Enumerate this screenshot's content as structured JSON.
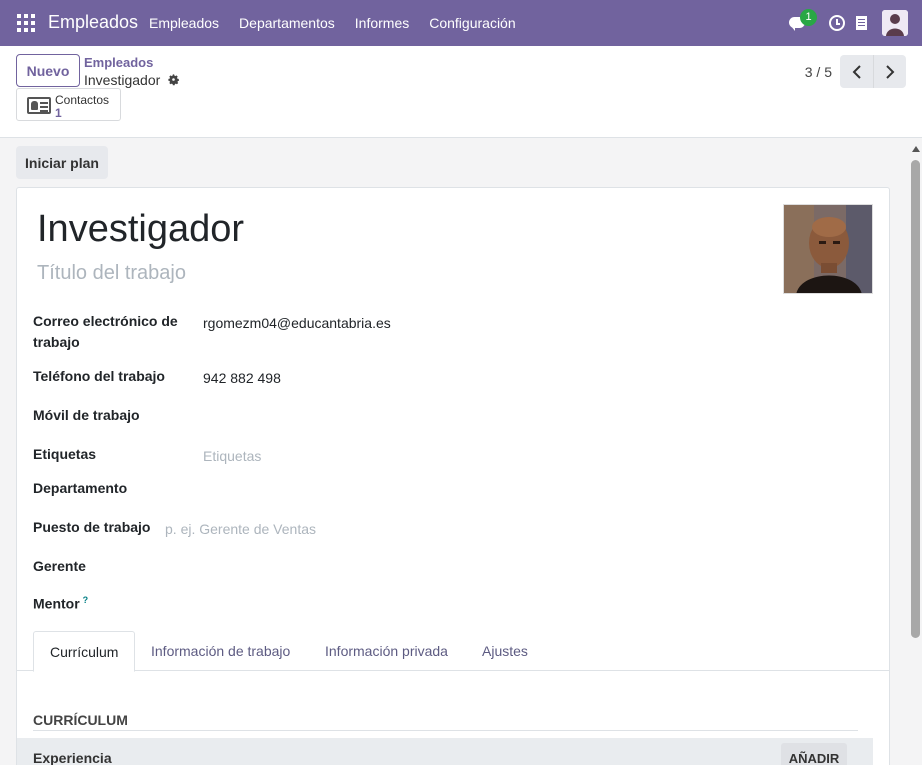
{
  "navbar": {
    "app_name": "Empleados",
    "menu": [
      "Empleados",
      "Departamentos",
      "Informes",
      "Configuración"
    ],
    "messages_count": "1",
    "accent_color": "#71639e"
  },
  "control_panel": {
    "new_button": "Nuevo",
    "breadcrumb_parent": "Empleados",
    "breadcrumb_current": "Investigador",
    "smart_button": {
      "label": "Contactos",
      "count": "1"
    },
    "pager": "3 / 5"
  },
  "statusbar": {
    "start_plan_button": "Iniciar plan"
  },
  "employee": {
    "name": "Investigador",
    "job_title_placeholder": "Título del trabajo"
  },
  "fields": {
    "work_email": {
      "label_line1": "Correo electrónico de",
      "label_line2": "trabajo",
      "value": "rgomezm04@educantabria.es"
    },
    "work_phone": {
      "label": "Teléfono del trabajo",
      "value": "942 882 498"
    },
    "mobile": {
      "label": "Móvil de trabajo",
      "value": ""
    },
    "tags": {
      "label": "Etiquetas",
      "placeholder": "Etiquetas"
    },
    "department": {
      "label": "Departamento",
      "value": ""
    },
    "job_position": {
      "label": "Puesto de trabajo",
      "placeholder": "p. ej. Gerente de Ventas"
    },
    "manager": {
      "label": "Gerente",
      "value": ""
    },
    "mentor": {
      "label": "Mentor",
      "help": "?"
    }
  },
  "tabs": [
    "Currículum",
    "Información de trabajo",
    "Información privada",
    "Ajustes"
  ],
  "resume": {
    "section_title": "CURRÍCULUM",
    "experience_label": "Experiencia",
    "add_button": "AÑADIR"
  }
}
